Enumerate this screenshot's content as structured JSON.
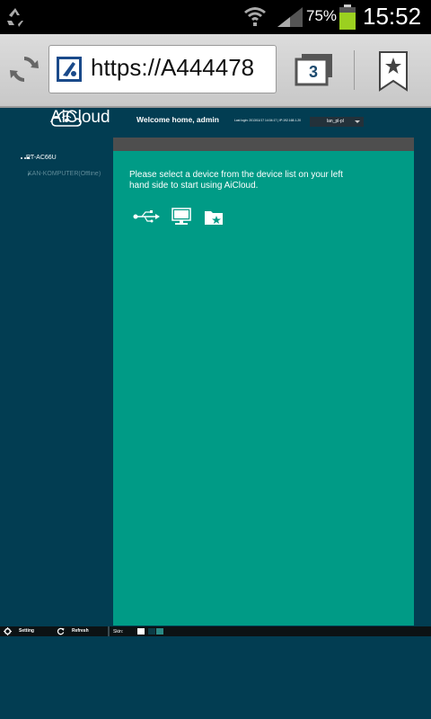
{
  "status_bar": {
    "battery_percent": "75%",
    "time": "15:52",
    "icons": [
      "recycle-icon",
      "wifi-icon",
      "signal-icon",
      "battery-icon"
    ]
  },
  "browser": {
    "url": "https://A444478",
    "tab_count": "3",
    "icons": [
      "reload-icon",
      "site-icon",
      "tabs-icon",
      "bookmark-icon"
    ]
  },
  "header": {
    "app_name": "AiCloud",
    "welcome": "Welcome home, admin",
    "last_login": "Last login: 2013/11/17 14:04:17 | IP:192.168.1.20",
    "language": "lan_pl-pl"
  },
  "devices": [
    {
      "label": "RT-AC66U"
    },
    {
      "label": "KAN-KOMPUTER(Offline)"
    }
  ],
  "main": {
    "instructions": "Please select a device from the device list on your left hand side to start using AiCloud.",
    "device_type_icons": [
      "usb-icon",
      "computer-icon",
      "cloud-folder-icon"
    ]
  },
  "bottom_bar": {
    "setting_label": "Setting",
    "refresh_label": "Refresh",
    "skin_label": "Skin:",
    "skins": [
      "#ffffff",
      "#0b3b45",
      "#2a8a85"
    ]
  },
  "colors": {
    "page_background": "#023d52",
    "content_panel": "#009b86",
    "content_header": "#4e4e4e"
  }
}
